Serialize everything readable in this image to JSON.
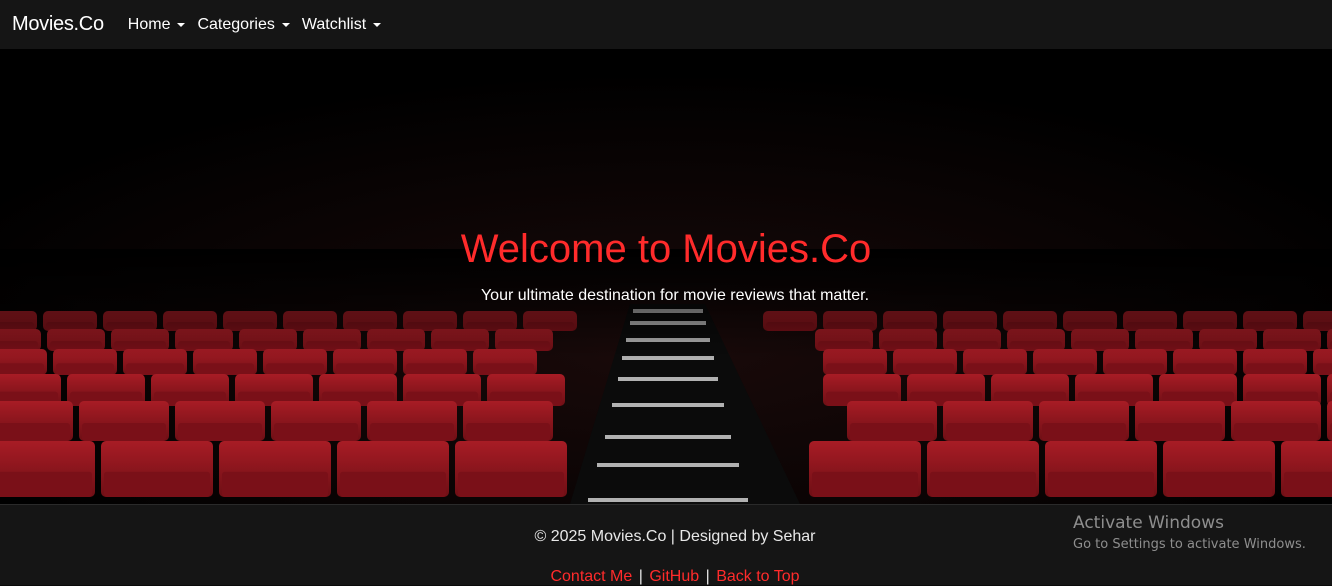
{
  "navbar": {
    "brand": "Movies.Co",
    "items": [
      {
        "label": "Home"
      },
      {
        "label": "Categories"
      },
      {
        "label": "Watchlist"
      }
    ]
  },
  "hero": {
    "title": "Welcome to Movies.Co",
    "subtitle": "Your ultimate destination for movie reviews that matter.",
    "accent_color": "#ff2b2b",
    "seat_color": "#9a1620"
  },
  "footer": {
    "copyright": "© 2025 Movies.Co | Designed by Sehar",
    "links": [
      {
        "label": "Contact Me"
      },
      {
        "label": "GitHub"
      },
      {
        "label": "Back to Top"
      }
    ],
    "separator": "|"
  },
  "watermark": {
    "title": "Activate Windows",
    "subtitle": "Go to Settings to activate Windows."
  }
}
